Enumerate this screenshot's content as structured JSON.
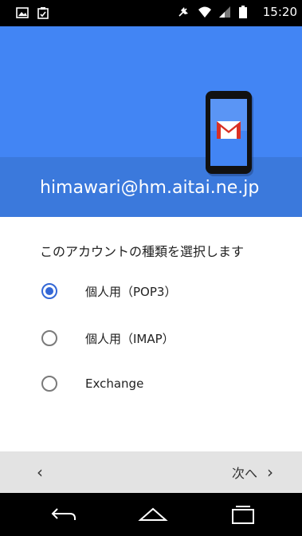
{
  "status_bar": {
    "time": "15:20",
    "icons": [
      "image-icon",
      "clipboard-icon",
      "mute-icon",
      "wifi-icon",
      "signal-icon",
      "battery-icon"
    ]
  },
  "header": {
    "email": "himawari@hm.aitai.ne.jp",
    "graphic": "gmail-icon",
    "color_top": "#4285f4",
    "color_bottom": "#3b79dc"
  },
  "account_type": {
    "question": "このアカウントの種類を選択します",
    "options": [
      {
        "label": "個人用（POP3）",
        "selected": true
      },
      {
        "label": "個人用（IMAP）",
        "selected": false
      },
      {
        "label": "Exchange",
        "selected": false
      }
    ]
  },
  "bottom_bar": {
    "back_symbol": "‹",
    "next_label": "次へ",
    "next_symbol": "›"
  },
  "nav_bar": {
    "buttons": [
      "back-icon",
      "home-icon",
      "recents-icon"
    ]
  }
}
